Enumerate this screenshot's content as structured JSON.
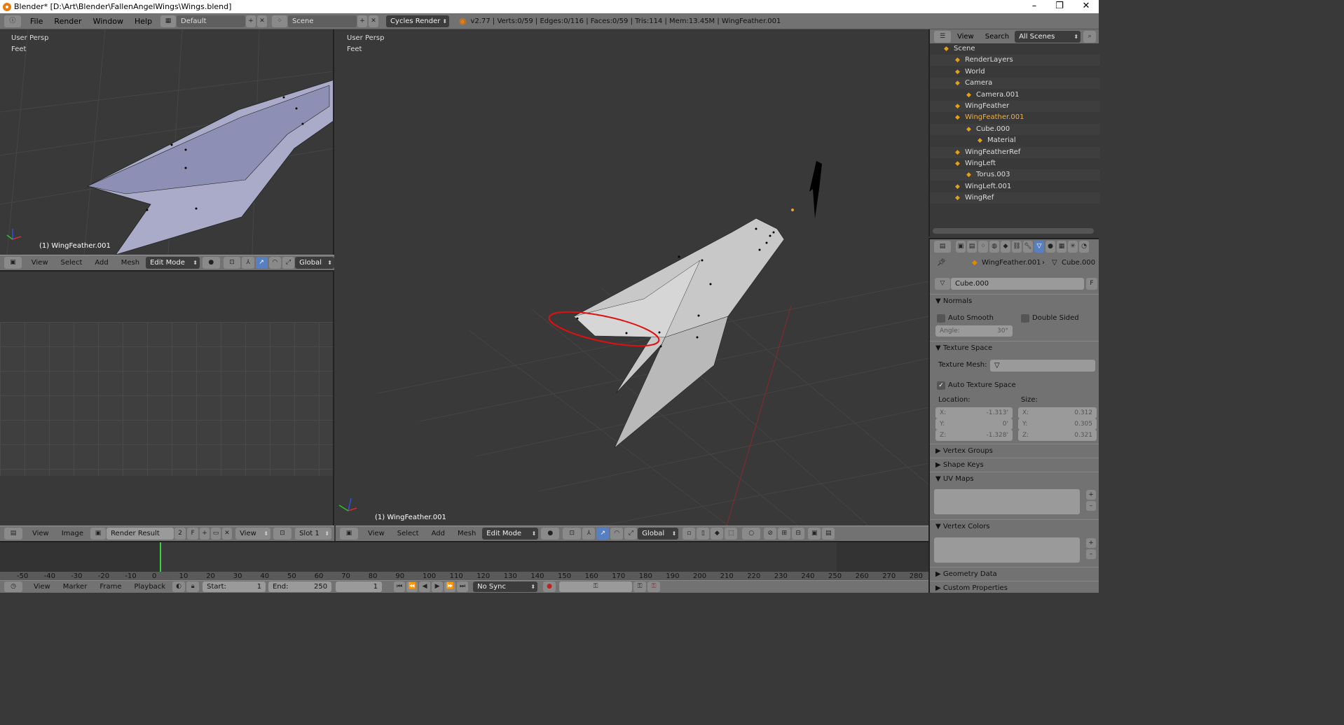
{
  "window": {
    "title": "Blender* [D:\\Art\\Blender\\FallenAngelWings\\Wings.blend]",
    "controls": [
      "–",
      "❐",
      "✕"
    ]
  },
  "infobar": {
    "menus": [
      "File",
      "Render",
      "Window",
      "Help"
    ],
    "layout": "Default",
    "scene": "Scene",
    "engine": "Cycles Render",
    "stats": "v2.77 | Verts:0/59 | Edges:0/116 | Faces:0/59 | Tris:114 | Mem:13.45M | WingFeather.001"
  },
  "viewport_left": {
    "persp": "User Persp",
    "units": "Feet",
    "object": "(1) WingFeather.001",
    "menus": [
      "View",
      "Select",
      "Add",
      "Mesh"
    ],
    "mode": "Edit Mode",
    "orientation": "Global"
  },
  "image_editor": {
    "menus": [
      "View",
      "Image"
    ],
    "image": "Render Result",
    "users": "2",
    "fake": "F",
    "view": "View",
    "slot": "Slot 1"
  },
  "viewport_main": {
    "persp": "User Persp",
    "units": "Feet",
    "object": "(1) WingFeather.001",
    "menus": [
      "View",
      "Select",
      "Add",
      "Mesh"
    ],
    "mode": "Edit Mode",
    "orientation": "Global"
  },
  "timeline": {
    "ticks": [
      "-50",
      "-40",
      "-30",
      "-20",
      "-10",
      "0",
      "10",
      "20",
      "30",
      "40",
      "50",
      "60",
      "70",
      "80",
      "90",
      "100",
      "110",
      "120",
      "130",
      "140",
      "150",
      "160",
      "170",
      "180",
      "190",
      "200",
      "210",
      "220",
      "230",
      "240",
      "250",
      "260",
      "270",
      "280"
    ],
    "menus": [
      "View",
      "Marker",
      "Frame",
      "Playback"
    ],
    "start_label": "Start:",
    "start": "1",
    "end_label": "End:",
    "end": "250",
    "current": "1",
    "sync": "No Sync"
  },
  "outliner": {
    "menus": [
      "View",
      "Search"
    ],
    "filter": "All Scenes",
    "items": [
      {
        "label": "Scene",
        "indent": 0,
        "color": "#ddd"
      },
      {
        "label": "RenderLayers",
        "indent": 1,
        "color": "#ddd"
      },
      {
        "label": "World",
        "indent": 1,
        "color": "#ddd"
      },
      {
        "label": "Camera",
        "indent": 1,
        "color": "#ddd"
      },
      {
        "label": "Camera.001",
        "indent": 2,
        "color": "#ddd"
      },
      {
        "label": "WingFeather",
        "indent": 1,
        "color": "#ddd"
      },
      {
        "label": "WingFeather.001",
        "indent": 1,
        "color": "#f0b040"
      },
      {
        "label": "Cube.000",
        "indent": 2,
        "color": "#ddd"
      },
      {
        "label": "Material",
        "indent": 3,
        "color": "#ddd"
      },
      {
        "label": "WingFeatherRef",
        "indent": 1,
        "color": "#ddd"
      },
      {
        "label": "WingLeft",
        "indent": 1,
        "color": "#ddd"
      },
      {
        "label": "Torus.003",
        "indent": 2,
        "color": "#ddd"
      },
      {
        "label": "WingLeft.001",
        "indent": 1,
        "color": "#ddd"
      },
      {
        "label": "WingRef",
        "indent": 1,
        "color": "#ddd"
      }
    ]
  },
  "properties": {
    "breadcrumb_object": "WingFeather.001",
    "breadcrumb_data": "Cube.000",
    "datablock": "Cube.000",
    "fake_user": "F",
    "normals": {
      "title": "Normals",
      "auto_smooth": "Auto Smooth",
      "double_sided": "Double Sided",
      "angle_label": "Angle:",
      "angle": "30°"
    },
    "texture_space": {
      "title": "Texture Space",
      "texture_mesh": "Texture Mesh:",
      "auto_texture_space": "Auto Texture Space",
      "location": "Location:",
      "size": "Size:",
      "loc": [
        {
          "axis": "X:",
          "val": "-1.313'"
        },
        {
          "axis": "Y:",
          "val": "0'"
        },
        {
          "axis": "Z:",
          "val": "-1.328'"
        }
      ],
      "sz": [
        {
          "axis": "X:",
          "val": "0.312"
        },
        {
          "axis": "Y:",
          "val": "0.305"
        },
        {
          "axis": "Z:",
          "val": "0.321"
        }
      ]
    },
    "panels": {
      "vertex_groups": "Vertex Groups",
      "shape_keys": "Shape Keys",
      "uv_maps": "UV Maps",
      "vertex_colors": "Vertex Colors",
      "geometry_data": "Geometry Data",
      "custom_properties": "Custom Properties"
    }
  }
}
